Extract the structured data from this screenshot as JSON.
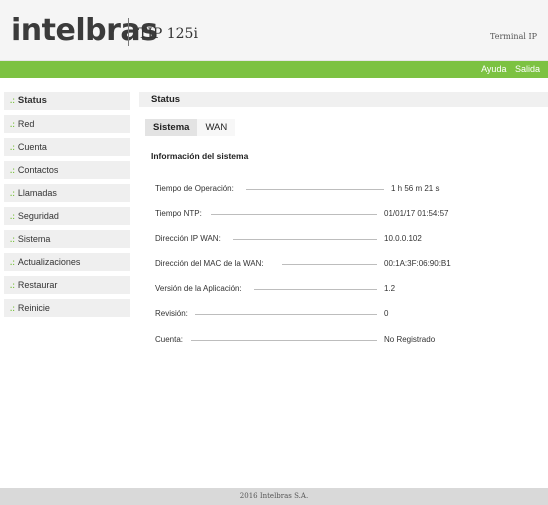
{
  "header": {
    "logo": "intelbras",
    "model": "TIP 125i",
    "subtitle": "Terminal IP"
  },
  "topnav": {
    "help": "Ayuda",
    "exit": "Salida"
  },
  "sidebar": {
    "items": [
      {
        "label": "Status"
      },
      {
        "label": "Red"
      },
      {
        "label": "Cuenta"
      },
      {
        "label": "Contactos"
      },
      {
        "label": "Llamadas"
      },
      {
        "label": "Seguridad"
      },
      {
        "label": "Sistema"
      },
      {
        "label": "Actualizaciones"
      },
      {
        "label": "Restaurar"
      },
      {
        "label": "Reinicie"
      }
    ],
    "bullet": ".:"
  },
  "main": {
    "heading": "Status",
    "tabs": [
      {
        "label": "Sistema"
      },
      {
        "label": "WAN"
      }
    ],
    "section_title": "Información del sistema",
    "rows": [
      {
        "label": "Tiempo de Operación:",
        "value": "1 h 56 m 21 s"
      },
      {
        "label": "Tiempo NTP:",
        "value": "01/01/17 01:54:57"
      },
      {
        "label": "Dirección IP WAN:",
        "value": "10.0.0.102"
      },
      {
        "label": "Dirección del MAC de la WAN:",
        "value": "00:1A:3F:06:90:B1"
      },
      {
        "label": "Versión de la Aplicación:",
        "value": "1.2"
      },
      {
        "label": "Revisión:",
        "value": "0"
      },
      {
        "label": "Cuenta:",
        "value": "No Registrado"
      }
    ]
  },
  "footer": {
    "text": "2016 Intelbras S.A."
  },
  "colors": {
    "accent": "#7cc242",
    "sidebar_bg": "#efefef",
    "footer_bg": "#d9d9d9"
  }
}
